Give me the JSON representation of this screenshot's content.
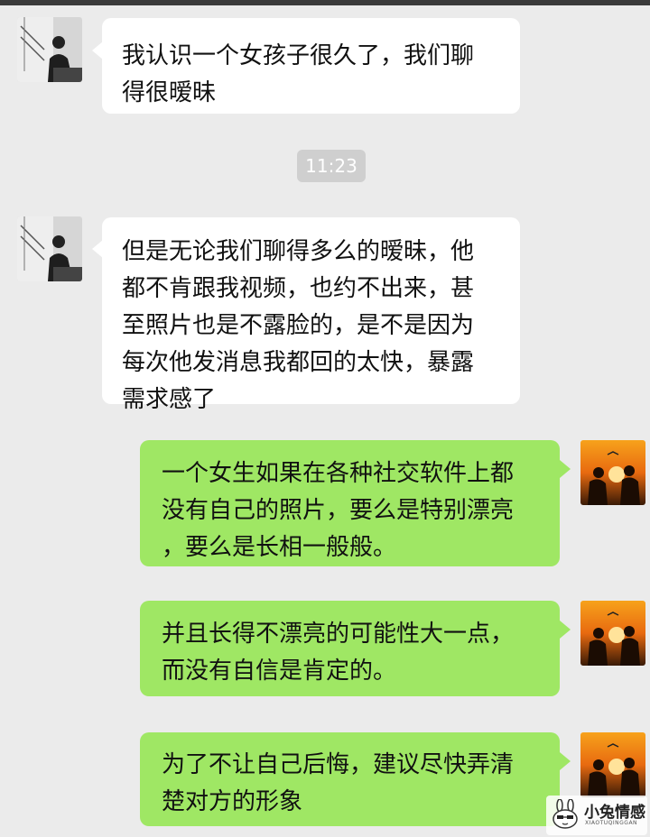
{
  "chat": {
    "timestamp": "11:23",
    "messages": [
      {
        "side": "incoming",
        "text": "我认识一个女孩子很久了，我们聊\n得很暧昧"
      },
      {
        "side": "incoming",
        "text": "但是无论我们聊得多么的暧昧，他\n都不肯跟我视频，也约不出来，甚\n至照片也是不露脸的，是不是因为\n每次他发消息我都回的太快，暴露\n需求感了"
      },
      {
        "side": "outgoing",
        "text": "一个女生如果在各种社交软件上都\n没有自己的照片，要么是特别漂亮\n，要么是长相一般般。"
      },
      {
        "side": "outgoing",
        "text": "并且长得不漂亮的可能性大一点，\n而没有自信是肯定的。"
      },
      {
        "side": "outgoing",
        "text": "为了不让自己后悔，建议尽快弄清\n楚对方的形象"
      }
    ]
  },
  "avatars": {
    "incoming": "avatar-grayscale-window-silhouette",
    "outgoing": "avatar-sunset-couple-silhouette"
  },
  "watermark": {
    "title": "小兔情感",
    "subtitle": "XIAOTUQINGGAN",
    "icon": "rabbit-face-icon"
  },
  "colors": {
    "background": "#ebebeb",
    "incoming_bubble": "#ffffff",
    "outgoing_bubble": "#9fe764",
    "timestamp_bg": "#cfcfcf"
  }
}
